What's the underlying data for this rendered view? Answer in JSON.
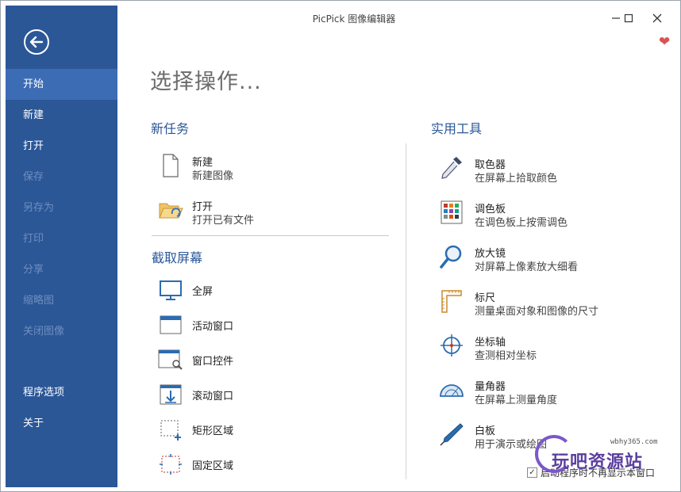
{
  "window": {
    "title": "PicPick 图像编辑器"
  },
  "sidebar": {
    "items": [
      {
        "label": "开始",
        "state": "active"
      },
      {
        "label": "新建",
        "state": "enabled"
      },
      {
        "label": "打开",
        "state": "enabled"
      },
      {
        "label": "保存",
        "state": "disabled"
      },
      {
        "label": "另存为",
        "state": "disabled"
      },
      {
        "label": "打印",
        "state": "disabled"
      },
      {
        "label": "分享",
        "state": "disabled"
      },
      {
        "label": "缩略图",
        "state": "disabled"
      },
      {
        "label": "关闭图像",
        "state": "disabled"
      },
      {
        "label": "程序选项",
        "state": "enabled"
      },
      {
        "label": "关于",
        "state": "enabled"
      }
    ]
  },
  "main": {
    "heading": "选择操作...",
    "new_task": {
      "title": "新任务",
      "items": [
        {
          "label": "新建",
          "desc": "新建图像",
          "icon": "blank-page-icon"
        },
        {
          "label": "打开",
          "desc": "打开已有文件",
          "icon": "open-folder-icon"
        }
      ]
    },
    "capture": {
      "title": "截取屏幕",
      "items": [
        {
          "label": "全屏",
          "icon": "monitor-icon"
        },
        {
          "label": "活动窗口",
          "icon": "active-window-icon"
        },
        {
          "label": "窗口控件",
          "icon": "window-control-icon"
        },
        {
          "label": "滚动窗口",
          "icon": "scroll-window-icon"
        },
        {
          "label": "矩形区域",
          "icon": "rectangle-region-icon"
        },
        {
          "label": "固定区域",
          "icon": "fixed-region-icon"
        }
      ]
    },
    "tools": {
      "title": "实用工具",
      "items": [
        {
          "label": "取色器",
          "desc": "在屏幕上拾取颜色",
          "icon": "eyedropper-icon"
        },
        {
          "label": "调色板",
          "desc": "在调色板上按需调色",
          "icon": "palette-icon"
        },
        {
          "label": "放大镜",
          "desc": "对屏幕上像素放大细看",
          "icon": "magnifier-icon"
        },
        {
          "label": "标尺",
          "desc": "测量桌面对象和图像的尺寸",
          "icon": "ruler-icon"
        },
        {
          "label": "坐标轴",
          "desc": "查测相对坐标",
          "icon": "crosshair-icon"
        },
        {
          "label": "量角器",
          "desc": "在屏幕上测量角度",
          "icon": "protractor-icon"
        },
        {
          "label": "白板",
          "desc": "用于演示或绘图",
          "icon": "pen-icon"
        }
      ]
    }
  },
  "footer": {
    "checkbox_label": "启动程序时不再显示本窗口",
    "checked": true
  },
  "watermark": {
    "url": "wbhy365.com",
    "text": "玩吧资源站"
  },
  "colors": {
    "sidebar": "#2b5797",
    "active": "#3c6cb4",
    "accent": "#2b5797"
  }
}
